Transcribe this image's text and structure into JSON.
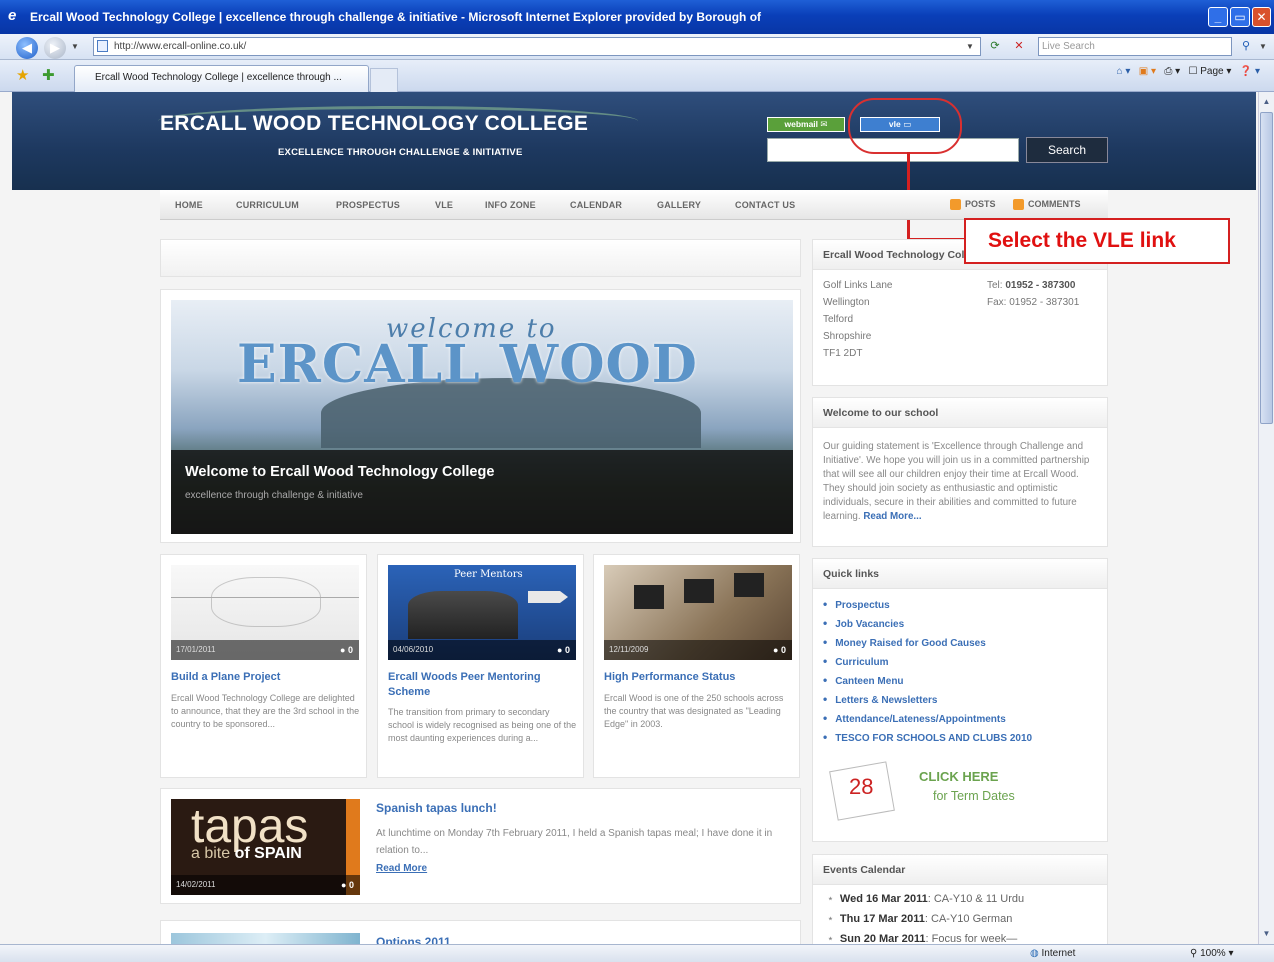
{
  "browser": {
    "title": "Ercall Wood Technology College | excellence through challenge & initiative - Microsoft Internet Explorer provided by Borough of",
    "url": "http://www.ercall-online.co.uk/",
    "live_search_placeholder": "Live Search",
    "tab_title": "Ercall Wood Technology College | excellence through ...",
    "page_menu": "Page",
    "zone": "Internet",
    "zoom": "100%"
  },
  "header": {
    "college_name": "ERCALL WOOD TECHNOLOGY COLLEGE",
    "tagline": "EXCELLENCE THROUGH CHALLENGE & INITIATIVE",
    "webmail_label": "webmail",
    "vle_label": "vle",
    "search_button": "Search"
  },
  "annotation": {
    "callout": "Select the VLE link"
  },
  "nav": {
    "items": [
      "HOME",
      "CURRICULUM",
      "PROSPECTUS",
      "VLE",
      "INFO ZONE",
      "CALENDAR",
      "GALLERY",
      "CONTACT US"
    ],
    "feeds": [
      "POSTS",
      "COMMENTS"
    ]
  },
  "featured": {
    "overlay_script": "welcome to",
    "overlay_name": "ERCALL WOOD",
    "title": "Welcome to Ercall Wood Technology College",
    "subtitle": "excellence through challenge & initiative"
  },
  "cards": [
    {
      "date": "17/01/2011",
      "comments": "0",
      "title": "Build a Plane Project",
      "text": "Ercall Wood Technology College are delighted to announce, that they are the 3rd school in the country to be sponsored..."
    },
    {
      "date": "04/06/2010",
      "comments": "0",
      "image_caption": "Peer Mentors",
      "title": "Ercall Woods Peer Mentoring Scheme",
      "text": "The transition from primary to secondary school is widely recognised as being one of the most daunting experiences during a..."
    },
    {
      "date": "12/11/2009",
      "comments": "0",
      "title": "High Performance Status",
      "text": "Ercall Wood is one of the 250 schools across the country that was designated as \"Leading Edge\" in 2003."
    }
  ],
  "post": {
    "image_word": "tapas",
    "image_sub_a": "a bite",
    "image_sub_b": "of SPAIN",
    "date": "14/02/2011",
    "comments": "0",
    "title": "Spanish tapas lunch!",
    "text": "At lunchtime on Monday 7th February 2011, I held a Spanish tapas meal; I have done it in relation to...",
    "read_more": "Read More"
  },
  "post2": {
    "title": "Options 2011"
  },
  "sidebar": {
    "contact": {
      "heading": "Ercall Wood Technology College",
      "address": [
        "Golf Links Lane",
        "Wellington",
        "Telford",
        "Shropshire",
        "TF1 2DT"
      ],
      "tel_label": "Tel:",
      "tel": "01952 - 387300",
      "fax": "Fax: 01952 - 387301"
    },
    "welcome": {
      "heading": "Welcome to our school",
      "text": "Our guiding statement is 'Excellence through Challenge and Initiative'. We hope you will join us in a committed partnership that will see all our children enjoy their time at Ercall Wood. They should join society as enthusiastic and optimistic individuals, secure in their abilities and committed to future learning.",
      "read_more": "Read More..."
    },
    "quick_links": {
      "heading": "Quick links",
      "items": [
        "Prospectus",
        "Job Vacancies",
        "Money Raised for Good Causes",
        "Curriculum",
        "Canteen Menu",
        "Letters & Newsletters",
        "Attendance/Lateness/Appointments",
        "TESCO FOR SCHOOLS AND CLUBS 2010"
      ],
      "calendar_num": "28",
      "click_here": "CLICK HERE",
      "term_dates": "for Term Dates"
    },
    "events": {
      "heading": "Events Calendar",
      "items": [
        {
          "date": "Wed 16 Mar 2011",
          "text": ": CA-Y10 & 11 Urdu"
        },
        {
          "date": "Thu 17 Mar 2011",
          "text": ": CA-Y10 German"
        },
        {
          "date": "Sun 20 Mar 2011",
          "text": ": Focus for week—"
        }
      ]
    }
  }
}
